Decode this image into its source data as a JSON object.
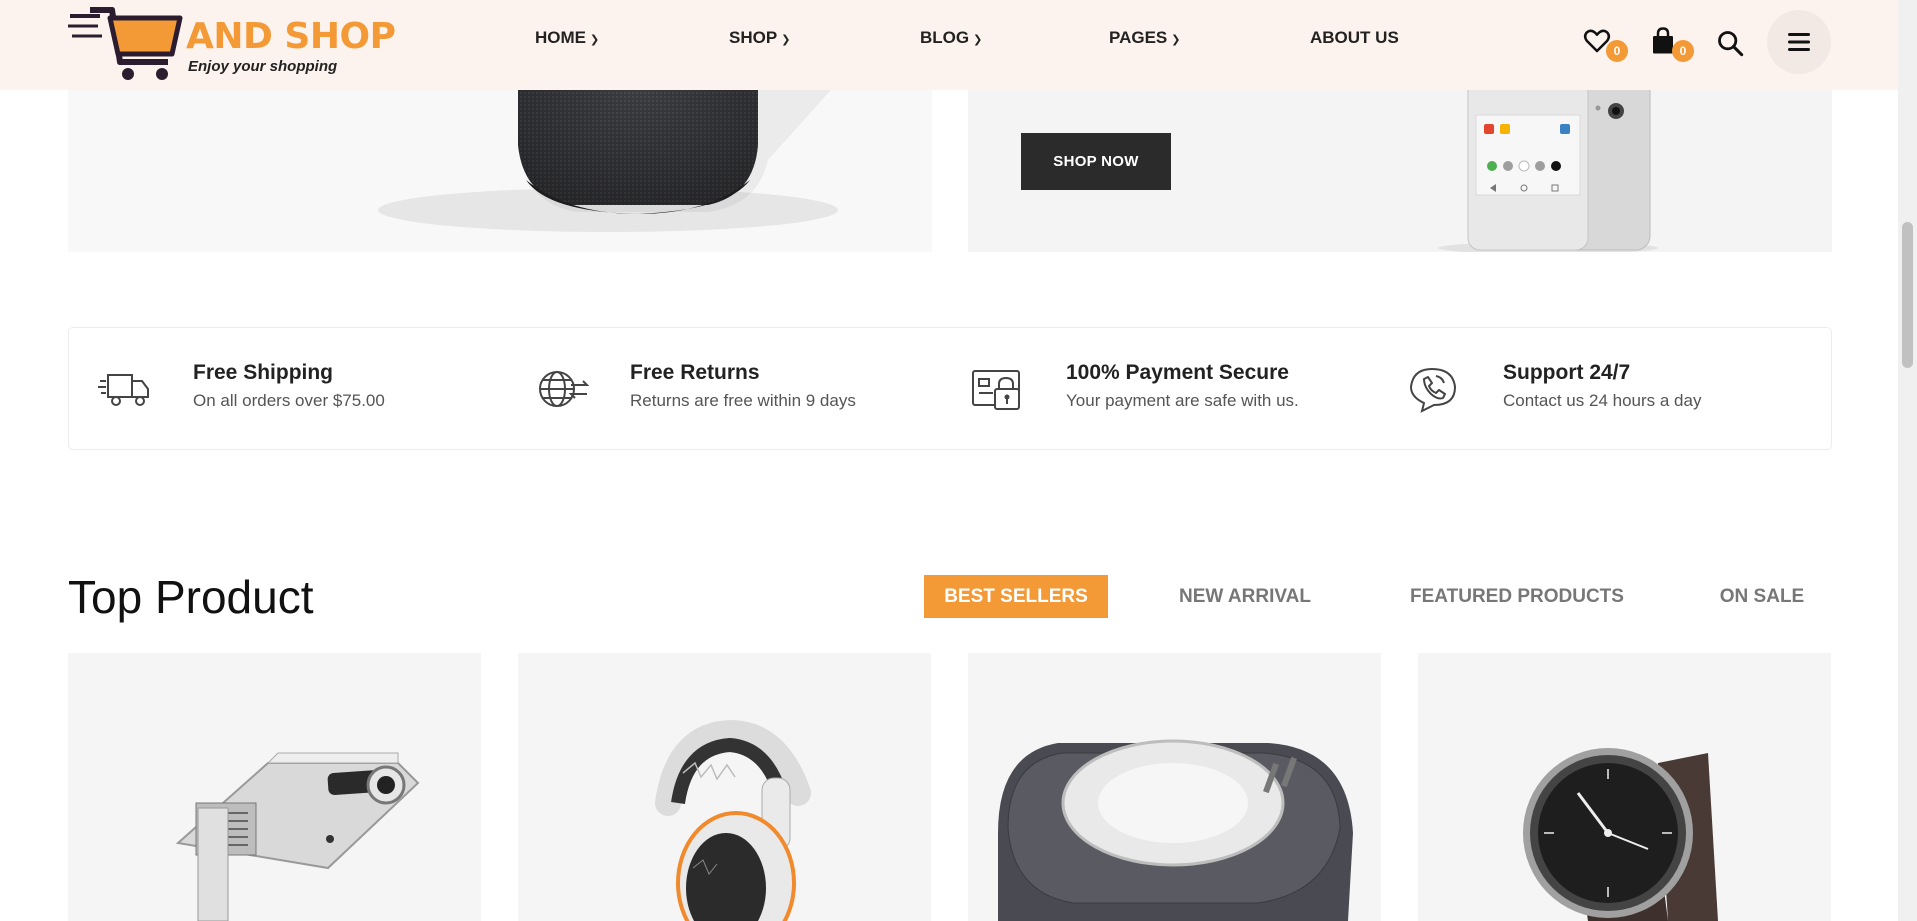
{
  "header": {
    "logo": {
      "name": "AND SHOP",
      "tagline": "Enjoy your shopping"
    },
    "nav": [
      {
        "label": "HOME",
        "has_dropdown": true
      },
      {
        "label": "SHOP",
        "has_dropdown": true
      },
      {
        "label": "BLOG",
        "has_dropdown": true
      },
      {
        "label": "PAGES",
        "has_dropdown": true
      },
      {
        "label": "ABOUT US",
        "has_dropdown": false
      }
    ],
    "wishlist_count": "0",
    "cart_count": "0",
    "icons": [
      "heart-icon",
      "shopping-bag-icon",
      "search-icon",
      "menu-icon"
    ]
  },
  "banners": {
    "right": {
      "button_label": "SHOP NOW"
    }
  },
  "features": [
    {
      "icon": "truck-icon",
      "title": "Free Shipping",
      "desc": "On all orders over $75.00"
    },
    {
      "icon": "globe-exchange-icon",
      "title": "Free Returns",
      "desc": "Returns are free within 9 days"
    },
    {
      "icon": "secure-payment-icon",
      "title": "100% Payment Secure",
      "desc": "Your payment are safe with us."
    },
    {
      "icon": "phone-support-icon",
      "title": "Support 24/7",
      "desc": "Contact us 24 hours a day"
    }
  ],
  "top_product": {
    "title": "Top Product",
    "tabs": [
      {
        "label": "BEST SELLERS",
        "active": true
      },
      {
        "label": "NEW ARRIVAL",
        "active": false
      },
      {
        "label": "FEATURED PRODUCTS",
        "active": false
      },
      {
        "label": "ON SALE",
        "active": false
      }
    ]
  },
  "colors": {
    "accent": "#f39a37",
    "header_bg": "#fdf3ee",
    "dark_button": "#2b2b2b"
  }
}
